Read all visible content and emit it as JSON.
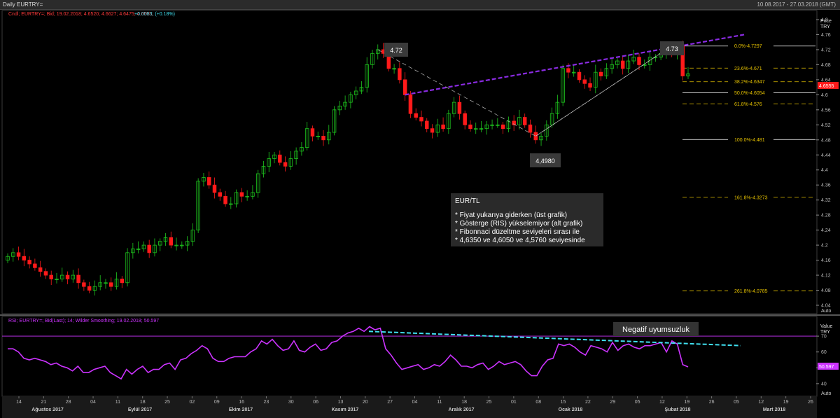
{
  "window": {
    "title": "Daily EURTRY=",
    "range": "10.08.2017 - 27.03.2018 (GMT)",
    "auto_label": "Auto"
  },
  "price_panel": {
    "legend_name": "Cndl; EURTRY=; Bid; 19.02.2018; 4.6520; 4.6627; 4.6475; 4.6555;",
    "legend_change": "+0.0083; (+0.18%)",
    "axis_title": "Price",
    "axis_unit": "TRY",
    "ticks": [
      "4.8",
      "4.76",
      "4.72",
      "4.68",
      "4.64",
      "4.6",
      "4.56",
      "4.52",
      "4.48",
      "4.44",
      "4.4",
      "4.36",
      "4.32",
      "4.28",
      "4.24",
      "4.2",
      "4.16",
      "4.12",
      "4.08",
      "4.04"
    ],
    "last_price": "4.6555",
    "callouts": [
      "4.72",
      "4.73",
      "4,4980"
    ],
    "fibonacci": [
      {
        "label": "0.0%-4.7297",
        "value": 4.7297
      },
      {
        "label": "23.6%-4.671",
        "value": 4.671
      },
      {
        "label": "38.2%-4.6347",
        "value": 4.6347
      },
      {
        "label": "50.0%-4.6054",
        "value": 4.6054
      },
      {
        "label": "61.8%-4.576",
        "value": 4.576
      },
      {
        "label": "100.0%-4.481",
        "value": 4.481
      },
      {
        "label": "161.8%-4.3273",
        "value": 4.3273
      },
      {
        "label": "261.8%-4.0785",
        "value": 4.0785
      }
    ],
    "note": {
      "title": "EUR/TL",
      "lines": [
        "* Fiyat yukarıya giderken (üst grafik)",
        "* Gösterge (RIS) yükselemiyor (alt grafik)",
        "* Fibonnaci düzeltme seviyeleri sırası ile",
        "* 4,6350 ve 4,6050 ve 4,5760 seviyesinde"
      ]
    }
  },
  "rsi_panel": {
    "legend": "RSI; EURTRY=; Bid(Last); 14; Wilder Smoothing; 19.02.2018; 50.597",
    "axis_title": "Value",
    "axis_unit": "TRY",
    "ticks": [
      "70",
      "60",
      "50",
      "40"
    ],
    "last_value": "50.597",
    "annotation": "Negatif uyumsuzluk"
  },
  "x_axis": {
    "day_ticks": [
      "14",
      "21",
      "28",
      "04",
      "11",
      "18",
      "25",
      "02",
      "09",
      "16",
      "23",
      "30",
      "06",
      "13",
      "20",
      "27",
      "04",
      "11",
      "18",
      "25",
      "01",
      "08",
      "15",
      "22",
      "29",
      "05",
      "12",
      "19",
      "26",
      "05",
      "12",
      "19",
      "26"
    ],
    "month_labels": [
      "Ağustos 2017",
      "Eylül 2017",
      "Ekim 2017",
      "Kasım 2017",
      "Aralık 2017",
      "Ocak 2018",
      "Şubat 2018",
      "Mart 2018"
    ]
  },
  "colors": {
    "up": "#1ec71e",
    "down": "#ff1a1a",
    "rsi": "#cc33ff",
    "fib": "#e6c200",
    "trend": "#8a2be2",
    "divergence": "#40e0f0"
  },
  "chart_data": [
    {
      "type": "candlestick",
      "title": "Daily EURTRY=",
      "ylabel": "Price TRY",
      "ylim": [
        4.02,
        4.82
      ],
      "ohlc_close": [
        4.17,
        4.18,
        4.17,
        4.16,
        4.15,
        4.14,
        4.13,
        4.12,
        4.11,
        4.11,
        4.12,
        4.11,
        4.12,
        4.1,
        4.09,
        4.08,
        4.09,
        4.1,
        4.1,
        4.09,
        4.11,
        4.1,
        4.18,
        4.19,
        4.19,
        4.2,
        4.18,
        4.2,
        4.21,
        4.22,
        4.2,
        4.2,
        4.2,
        4.21,
        4.24,
        4.37,
        4.38,
        4.36,
        4.34,
        4.33,
        4.31,
        4.31,
        4.34,
        4.33,
        4.33,
        4.34,
        4.39,
        4.41,
        4.43,
        4.44,
        4.42,
        4.41,
        4.43,
        4.45,
        4.46,
        4.51,
        4.49,
        4.49,
        4.48,
        4.5,
        4.56,
        4.57,
        4.58,
        4.6,
        4.61,
        4.62,
        4.68,
        4.71,
        4.72,
        4.71,
        4.67,
        4.67,
        4.64,
        4.6,
        4.55,
        4.54,
        4.53,
        4.51,
        4.5,
        4.52,
        4.51,
        4.55,
        4.58,
        4.55,
        4.52,
        4.51,
        4.51,
        4.51,
        4.52,
        4.52,
        4.52,
        4.51,
        4.53,
        4.52,
        4.54,
        4.52,
        4.5,
        4.48,
        4.49,
        4.52,
        4.55,
        4.58,
        4.67,
        4.66,
        4.66,
        4.64,
        4.63,
        4.62,
        4.66,
        4.65,
        4.67,
        4.68,
        4.69,
        4.67,
        4.69,
        4.7,
        4.68,
        4.68,
        4.7,
        4.7,
        4.71,
        4.72,
        4.71,
        4.73,
        4.65,
        4.6555
      ],
      "series_name": "",
      "extremes": {
        "high_1": 4.72,
        "low": 4.498,
        "high_2": 4.73
      }
    },
    {
      "type": "line",
      "title": "",
      "ylabel": "Value TRY",
      "ylim": [
        32,
        78
      ],
      "values": [
        62,
        62,
        60,
        56,
        55,
        56,
        55,
        54,
        52,
        53,
        51,
        50,
        48,
        51,
        47,
        47,
        49,
        50,
        51,
        47,
        45,
        43,
        49,
        46,
        49,
        51,
        47,
        49,
        49,
        52,
        53,
        49,
        55,
        56,
        59,
        61,
        64,
        62,
        56,
        54,
        54,
        56,
        57,
        57,
        57,
        60,
        62,
        67,
        65,
        68,
        64,
        61,
        62,
        67,
        61,
        60,
        63,
        65,
        61,
        62,
        66,
        67,
        70,
        72,
        73,
        75,
        73,
        76,
        74,
        75,
        62,
        58,
        53,
        49,
        50,
        51,
        52,
        49,
        50,
        52,
        51,
        54,
        58,
        55,
        51,
        51,
        50,
        52,
        53,
        49,
        51,
        54,
        52,
        53,
        54,
        52,
        48,
        45,
        45,
        51,
        55,
        56,
        65,
        64,
        65,
        63,
        60,
        58,
        64,
        63,
        62,
        60,
        66,
        61,
        64,
        65,
        63,
        62,
        64,
        64,
        65,
        66,
        60,
        67,
        65,
        52,
        50.597
      ],
      "series_name": "RSI"
    }
  ]
}
